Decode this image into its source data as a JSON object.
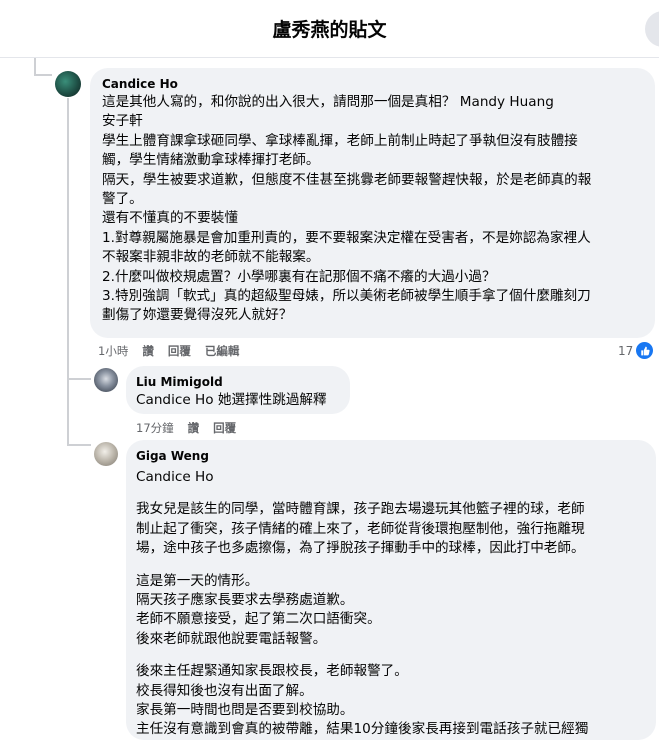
{
  "header": {
    "title": "盧秀燕的貼文"
  },
  "comments": [
    {
      "author": "Candice Ho",
      "lines": [
        "這是其他人寫的，和你說的出入很大，請問那一個是真相？ Mandy Huang",
        "安子軒",
        "學生上體育課拿球砸同學、拿球棒亂揮，老師上前制止時起了爭執但沒有肢體接",
        "觸，學生情緒激動拿球棒揮打老師。",
        "隔天，學生被要求道歉，但態度不佳甚至挑釁老師要報警趕快報，於是老師真的報",
        "警了。",
        "還有不懂真的不要裝懂",
        "1.對尊親屬施暴是會加重刑責的，要不要報案決定權在受害者，不是妳認為家裡人",
        "不報案非親非故的老師就不能報案。",
        "2.什麼叫做校規處置？小學哪裏有在記那個不痛不癢的大過小過？",
        "3.特別強調「軟式」真的超級聖母婊，所以美術老師被學生順手拿了個什麼雕刻刀",
        "劃傷了妳還要覺得沒死人就好？"
      ],
      "time": "1小時",
      "like": "讚",
      "reply": "回覆",
      "edited": "已編輯",
      "reactions": "17"
    },
    {
      "author": "Liu Mimigold",
      "text": "Candice Ho 她選擇性跳過解釋",
      "time": "17分鐘",
      "like": "讚",
      "reply": "回覆"
    },
    {
      "author": "Giga Weng",
      "mention": "Candice Ho",
      "paragraphs": [
        [
          "我女兒是該生的同學，當時體育課，孩子跑去場邊玩其他籃子裡的球，老師",
          "制止起了衝突，孩子情緒的確上來了，老師從背後環抱壓制他，強行拖離現",
          "場，途中孩子也多處擦傷，為了掙脫孩子揮動手中的球棒，因此打中老師。"
        ],
        [
          "這是第一天的情形。",
          "隔天孩子應家長要求去學務處道歉。",
          "老師不願意接受，起了第二次口語衝突。",
          "後來老師就跟他說要電話報警。"
        ],
        [
          "後來主任趕緊通知家長跟校長，老師報警了。",
          "校長得知後也沒有出面了解。",
          "家長第一時間也問是否要到校協助。",
          "主任沒有意識到會真的被帶離，結果10分鐘後家長再接到電話孩子就已經獨"
        ]
      ]
    }
  ],
  "colors": {
    "like_badge": "#1877f2",
    "bubble": "#f0f2f5",
    "meta": "#65676b"
  }
}
